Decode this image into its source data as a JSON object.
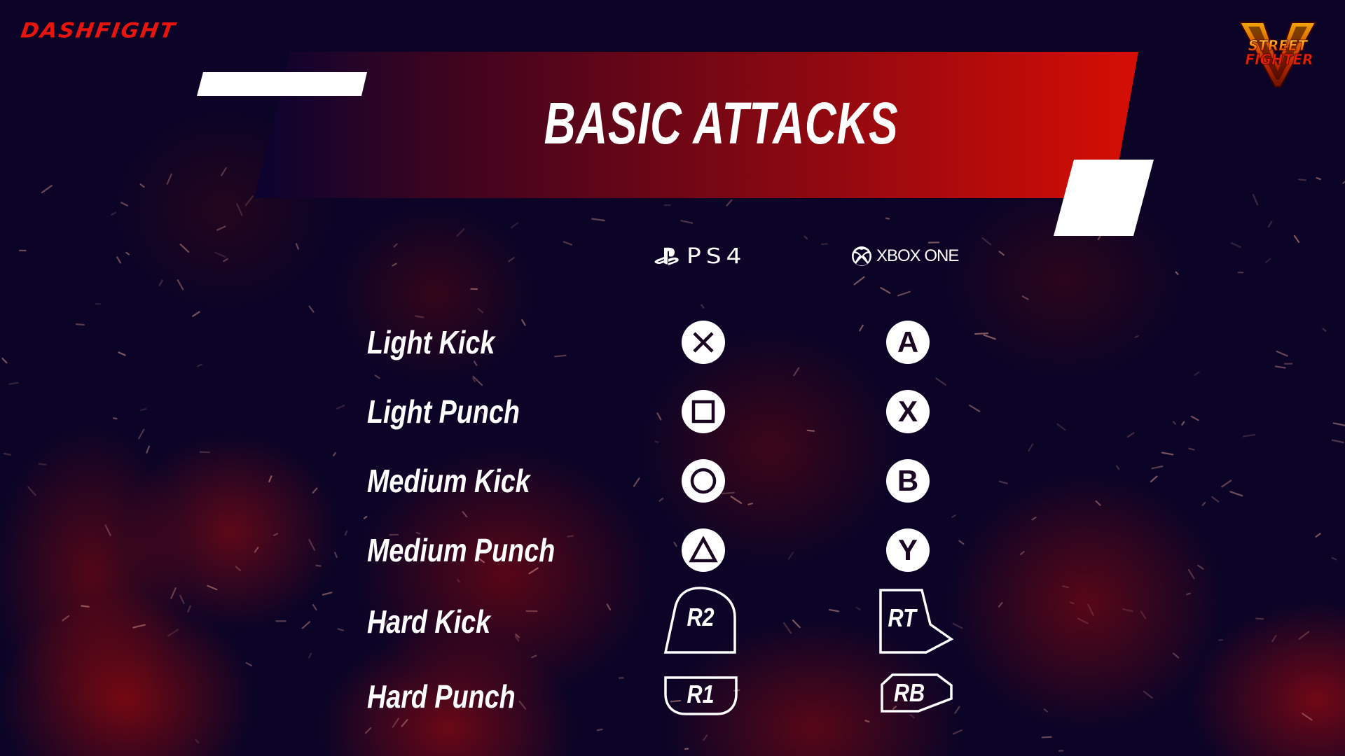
{
  "branding": {
    "site_logo": "DASHFIGHT",
    "game_logo_icon": "street-fighter-v-logo",
    "game_logo_text": [
      "STREET",
      "FIGHTER"
    ],
    "game_logo_letter": "V"
  },
  "header": {
    "title": "BASIC ATTACKS"
  },
  "colors": {
    "accent_red": "#d60e03",
    "background": "#0c0426",
    "logo_red": "#e8150f",
    "white": "#ffffff"
  },
  "platforms": {
    "ps4": {
      "icon": "playstation-icon",
      "label": "PS4"
    },
    "xbox": {
      "icon": "xbox-icon",
      "label": "XBOX ONE"
    }
  },
  "rows": [
    {
      "action": "Light Kick",
      "ps4": {
        "icon": "cross-button-icon",
        "label": "×"
      },
      "xbox": {
        "icon": "a-button-icon",
        "label": "A"
      }
    },
    {
      "action": "Light Punch",
      "ps4": {
        "icon": "square-button-icon",
        "label": "□"
      },
      "xbox": {
        "icon": "x-button-icon",
        "label": "X"
      }
    },
    {
      "action": "Medium Kick",
      "ps4": {
        "icon": "circle-button-icon",
        "label": "○"
      },
      "xbox": {
        "icon": "b-button-icon",
        "label": "B"
      }
    },
    {
      "action": "Medium Punch",
      "ps4": {
        "icon": "triangle-button-icon",
        "label": "△"
      },
      "xbox": {
        "icon": "y-button-icon",
        "label": "Y"
      }
    },
    {
      "action": "Hard Kick",
      "ps4": {
        "icon": "r2-trigger-icon",
        "label": "R2"
      },
      "xbox": {
        "icon": "rt-trigger-icon",
        "label": "RT"
      }
    },
    {
      "action": "Hard Punch",
      "ps4": {
        "icon": "r1-bumper-icon",
        "label": "R1"
      },
      "xbox": {
        "icon": "rb-bumper-icon",
        "label": "RB"
      }
    }
  ]
}
